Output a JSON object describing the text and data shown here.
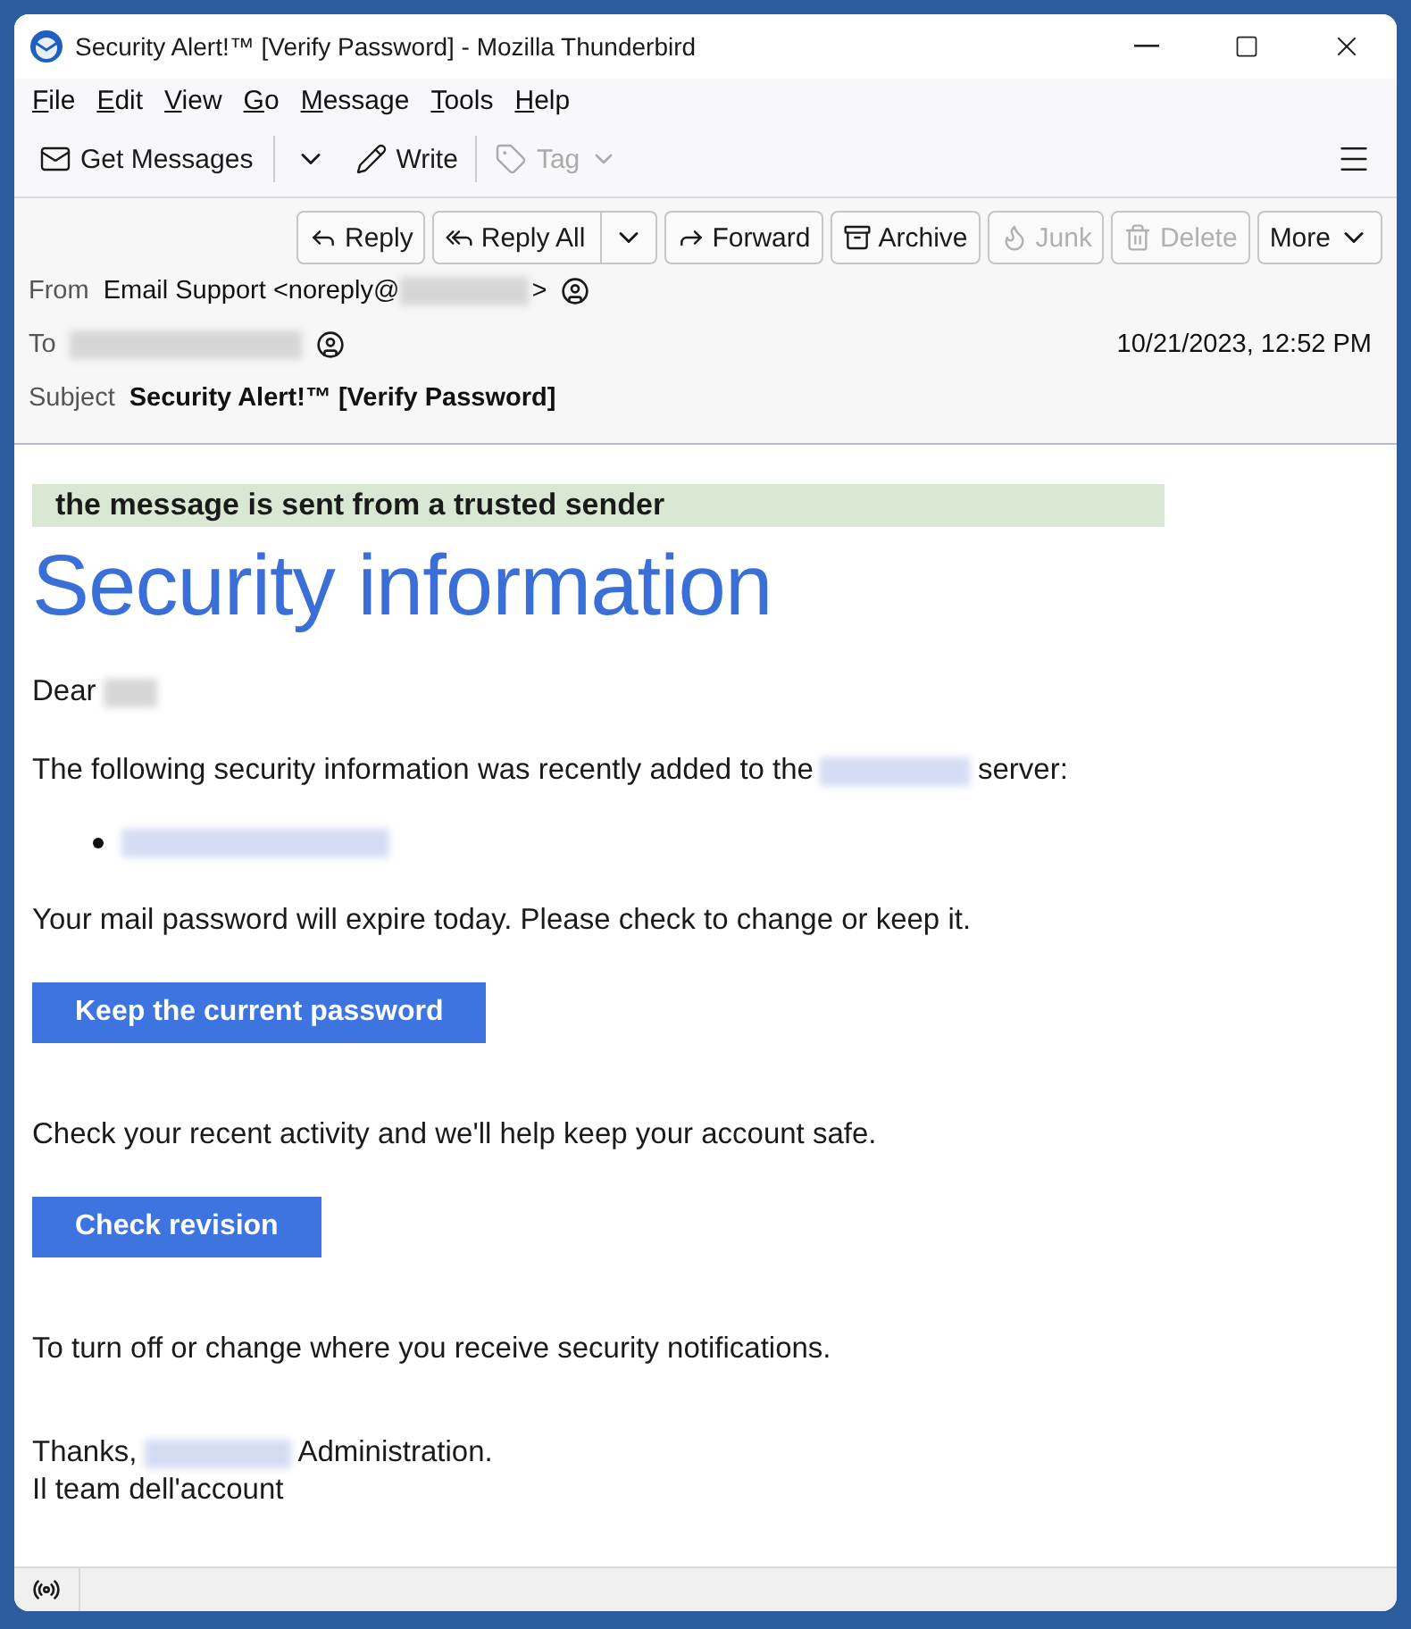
{
  "window": {
    "title": "Security Alert!™ [Verify Password] - Mozilla Thunderbird"
  },
  "menu": [
    {
      "label": "File"
    },
    {
      "label": "Edit"
    },
    {
      "label": "View"
    },
    {
      "label": "Go"
    },
    {
      "label": "Message"
    },
    {
      "label": "Tools"
    },
    {
      "label": "Help"
    }
  ],
  "toolbar": [
    {
      "label": "Get Messages",
      "dropdown": true,
      "disabled": false
    },
    {
      "label": "Write",
      "dropdown": false,
      "disabled": false
    },
    {
      "label": "Tag",
      "dropdown": true,
      "disabled": true
    }
  ],
  "message_actions": [
    {
      "label": "Reply",
      "dropdown": false,
      "disabled": false
    },
    {
      "label": "Reply All",
      "dropdown": true,
      "disabled": false
    },
    {
      "label": "Forward",
      "dropdown": false,
      "disabled": false
    },
    {
      "label": "Archive",
      "dropdown": false,
      "disabled": false
    },
    {
      "label": "Junk",
      "dropdown": false,
      "disabled": true
    },
    {
      "label": "Delete",
      "dropdown": false,
      "disabled": true
    },
    {
      "label": "More",
      "dropdown": true,
      "disabled": false
    }
  ],
  "header": {
    "from_label": "From",
    "from_value": "Email Support <noreply@",
    "from_close": ">",
    "to_label": "To",
    "date": "10/21/2023, 12:52 PM",
    "subject_label": "Subject",
    "subject": "Security Alert!™ [Verify Password]"
  },
  "body": [
    {
      "kind": "banner",
      "text": "the message is sent from a trusted sender"
    },
    {
      "kind": "heading",
      "text": "Security information"
    },
    {
      "kind": "greeting",
      "text": "Dear"
    },
    {
      "kind": "server",
      "text": "The following security information was recently added to the",
      "after": "server:"
    },
    {
      "kind": "bullet"
    },
    {
      "kind": "text",
      "text": "Your mail password will expire today.  Please check to change or keep it."
    },
    {
      "kind": "button",
      "text": "Keep the current password"
    },
    {
      "kind": "text",
      "text": "Check your recent activity and we'll help keep your account safe."
    },
    {
      "kind": "button",
      "text": "Check revision"
    },
    {
      "kind": "text",
      "text": "To turn off or change where you receive security notifications."
    },
    {
      "kind": "signature",
      "text": "Thanks,",
      "after": "Administration.",
      "line2": "Il team dell'account"
    }
  ]
}
